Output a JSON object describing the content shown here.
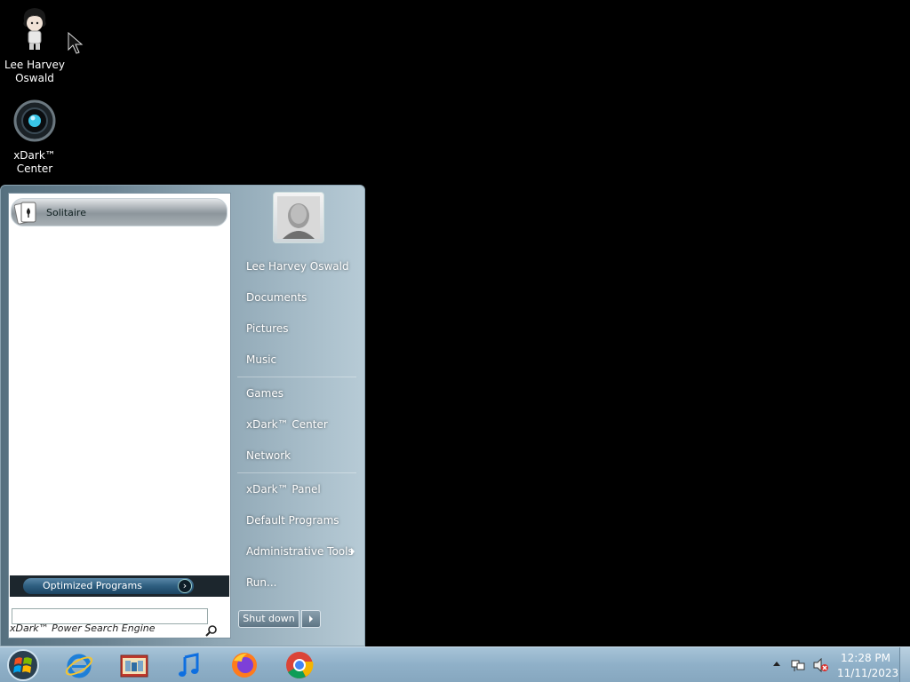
{
  "desktop": {
    "icons": [
      {
        "label": "Lee Harvey Oswald",
        "icon": "user-doll-icon"
      },
      {
        "label": "xDark™ Center",
        "icon": "xdark-orb-icon"
      }
    ]
  },
  "start_menu": {
    "pinned": [
      {
        "label": "Solitaire",
        "icon": "solitaire-cards-icon"
      }
    ],
    "optimized_programs": "Optimized Programs",
    "search_placeholder": "xDark™ Power Search Engine",
    "right_items": [
      {
        "label": "Lee Harvey Oswald"
      },
      {
        "label": "Documents"
      },
      {
        "label": "Pictures"
      },
      {
        "label": "Music"
      },
      {
        "label": "Games"
      },
      {
        "label": "xDark™ Center"
      },
      {
        "label": "Network"
      },
      {
        "label": "xDark™ Panel"
      },
      {
        "label": "Default Programs"
      },
      {
        "label": "Administrative Tools"
      },
      {
        "label": "Run..."
      }
    ],
    "shutdown_label": "Shut down"
  },
  "taskbar": {
    "apps": [
      "internet-explorer-icon",
      "windows-explorer-icon",
      "itunes-icon",
      "firefox-icon",
      "chrome-icon"
    ],
    "clock": {
      "time": "12:28 PM",
      "date": "11/11/2023"
    }
  }
}
